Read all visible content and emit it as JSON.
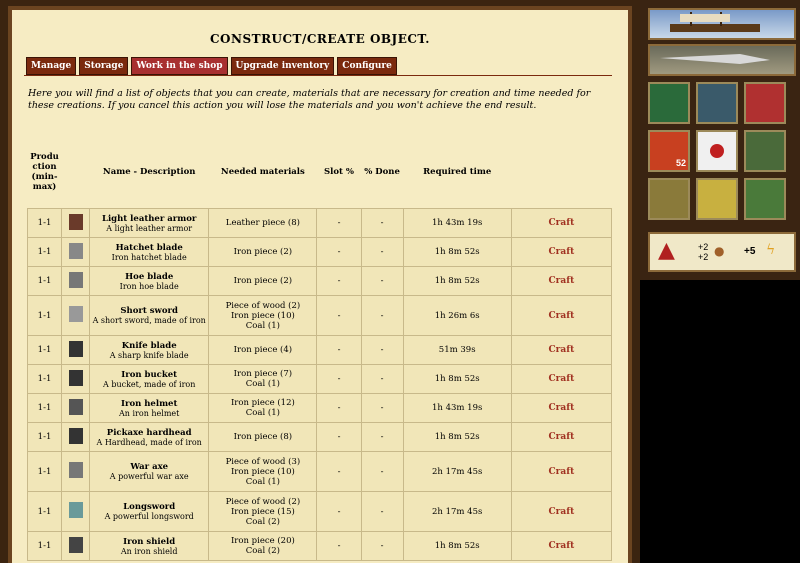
{
  "page_title": "CONSTRUCT/CREATE OBJECT.",
  "tabs": [
    {
      "label": "Manage",
      "active": false
    },
    {
      "label": "Storage",
      "active": false
    },
    {
      "label": "Work in the shop",
      "active": true
    },
    {
      "label": "Upgrade inventory",
      "active": false
    },
    {
      "label": "Configure",
      "active": false
    }
  ],
  "intro": "Here you will find a list of objects that you can create, materials that are necessary for creation and time needed for these creations. If you cancel this action you will lose the materials and you won't achieve the end result.",
  "columns": {
    "production": "Produ ction (min- max)",
    "name": "Name - Description",
    "materials": "Needed materials",
    "slot": "Slot %",
    "done": "% Done",
    "time": "Required time"
  },
  "rows": [
    {
      "prod": "1-1",
      "icon": "leather-armor-icon",
      "name": "Light leather armor",
      "desc": "A light leather armor",
      "materials": [
        "Leather piece (8)"
      ],
      "slot": "-",
      "done": "-",
      "time": "1h 43m 19s",
      "action": "Craft"
    },
    {
      "prod": "1-1",
      "icon": "hatchet-blade-icon",
      "name": "Hatchet blade",
      "desc": "Iron hatchet blade",
      "materials": [
        "Iron piece (2)"
      ],
      "slot": "-",
      "done": "-",
      "time": "1h 8m 52s",
      "action": "Craft"
    },
    {
      "prod": "1-1",
      "icon": "hoe-blade-icon",
      "name": "Hoe blade",
      "desc": "Iron hoe blade",
      "materials": [
        "Iron piece (2)"
      ],
      "slot": "-",
      "done": "-",
      "time": "1h 8m 52s",
      "action": "Craft"
    },
    {
      "prod": "1-1",
      "icon": "short-sword-icon",
      "name": "Short sword",
      "desc": "A short sword, made of iron",
      "materials": [
        "Piece of wood (2)",
        "Iron piece (10)",
        "Coal (1)"
      ],
      "slot": "-",
      "done": "-",
      "time": "1h 26m 6s",
      "action": "Craft"
    },
    {
      "prod": "1-1",
      "icon": "knife-blade-icon",
      "name": "Knife blade",
      "desc": "A sharp knife blade",
      "materials": [
        "Iron piece (4)"
      ],
      "slot": "-",
      "done": "-",
      "time": "51m 39s",
      "action": "Craft"
    },
    {
      "prod": "1-1",
      "icon": "iron-bucket-icon",
      "name": "Iron bucket",
      "desc": "A bucket, made of iron",
      "materials": [
        "Iron piece (7)",
        "Coal (1)"
      ],
      "slot": "-",
      "done": "-",
      "time": "1h 8m 52s",
      "action": "Craft"
    },
    {
      "prod": "1-1",
      "icon": "iron-helmet-icon",
      "name": "Iron helmet",
      "desc": "An iron helmet",
      "materials": [
        "Iron piece (12)",
        "Coal (1)"
      ],
      "slot": "-",
      "done": "-",
      "time": "1h 43m 19s",
      "action": "Craft"
    },
    {
      "prod": "1-1",
      "icon": "pickaxe-icon",
      "name": "Pickaxe hardhead",
      "desc": "A Hardhead, made of iron",
      "materials": [
        "Iron piece (8)"
      ],
      "slot": "-",
      "done": "-",
      "time": "1h 8m 52s",
      "action": "Craft"
    },
    {
      "prod": "1-1",
      "icon": "war-axe-icon",
      "name": "War axe",
      "desc": "A powerful war axe",
      "materials": [
        "Piece of wood (3)",
        "Iron piece (10)",
        "Coal (1)"
      ],
      "slot": "-",
      "done": "-",
      "time": "2h 17m 45s",
      "action": "Craft"
    },
    {
      "prod": "1-1",
      "icon": "longsword-icon",
      "name": "Longsword",
      "desc": "A powerful longsword",
      "materials": [
        "Piece of wood (2)",
        "Iron piece (15)",
        "Coal (2)"
      ],
      "slot": "-",
      "done": "-",
      "time": "2h 17m 45s",
      "action": "Craft"
    },
    {
      "prod": "1-1",
      "icon": "iron-shield-icon",
      "name": "Iron shield",
      "desc": "An iron shield",
      "materials": [
        "Iron piece (20)",
        "Coal (2)"
      ],
      "slot": "-",
      "done": "-",
      "time": "1h 8m 52s",
      "action": "Craft"
    }
  ],
  "sidebar": {
    "badge_count": "52",
    "stat_a": "+2",
    "stat_a_sub": "+2",
    "stat_b": "+5",
    "icons": [
      "character-icon",
      "sword-icon",
      "eagle-crest-icon",
      "dice-icon",
      "japan-flag-icon",
      "soldiers-icon",
      "gold-coins-icon",
      "coin-pile-icon",
      "scroll-icon"
    ]
  }
}
